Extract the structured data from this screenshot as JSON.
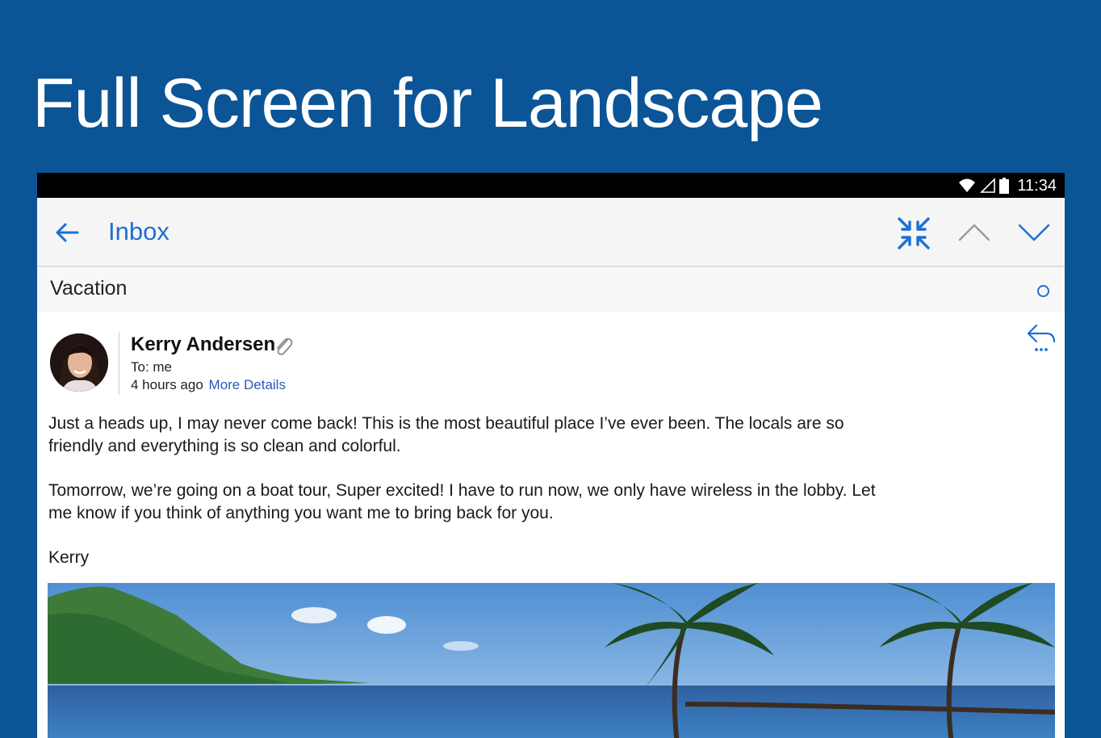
{
  "headline": "Full Screen for Landscape",
  "status_bar": {
    "time": "11:34",
    "icons": [
      "wifi-icon",
      "signal-icon",
      "battery-icon"
    ]
  },
  "app_bar": {
    "back_icon": "arrow-left-icon",
    "title": "Inbox",
    "actions": [
      "collapse-fullscreen-icon",
      "chevron-up-icon",
      "chevron-down-icon"
    ]
  },
  "message": {
    "subject": "Vacation",
    "sender": "Kerry Andersen",
    "to_line": "To: me",
    "time_ago": "4 hours ago",
    "more_details": "More Details",
    "body": [
      "Just a heads up, I may never come back! This is the most beautiful place I’ve ever been. The locals are so friendly and everything is so clean and colorful.",
      "Tomorrow, we’re going on a boat tour, Super excited! I have to run now, we only have wireless in the lobby. Let me know if you think of anything you want me to bring back for you.",
      "Kerry"
    ]
  },
  "colors": {
    "background": "#0b5496",
    "accent": "#1e6fd1",
    "link": "#2b57b8"
  }
}
